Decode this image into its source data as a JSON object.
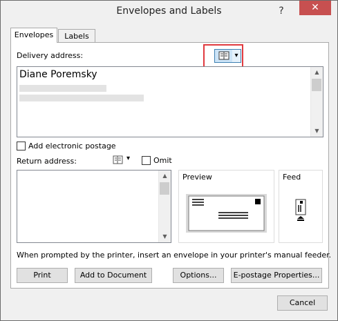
{
  "window": {
    "title": "Envelopes and Labels",
    "help": "?",
    "close": "✕"
  },
  "tabs": [
    {
      "label": "Envelopes"
    },
    {
      "label": "Labels"
    }
  ],
  "delivery": {
    "label": "Delivery address:",
    "name": "Diane Poremsky",
    "address_book_icon": "address-book-icon",
    "dropdown_icon": "▾"
  },
  "postage": {
    "label": "Add electronic postage",
    "checked": false
  },
  "return": {
    "label": "Return address:",
    "omit_label": "Omit",
    "omit_checked": false,
    "address_book_icon": "address-book-icon",
    "dropdown_icon": "▾"
  },
  "preview": {
    "label": "Preview"
  },
  "feed": {
    "label": "Feed"
  },
  "status": {
    "text": "When prompted by the printer, insert an envelope in your printer's manual feeder."
  },
  "buttons": {
    "print": "Print",
    "add_to_document": "Add to Document",
    "options": "Options...",
    "epostage": "E-postage Properties...",
    "cancel": "Cancel"
  },
  "colors": {
    "highlight": "#e0393e",
    "close_bg": "#c75050"
  }
}
